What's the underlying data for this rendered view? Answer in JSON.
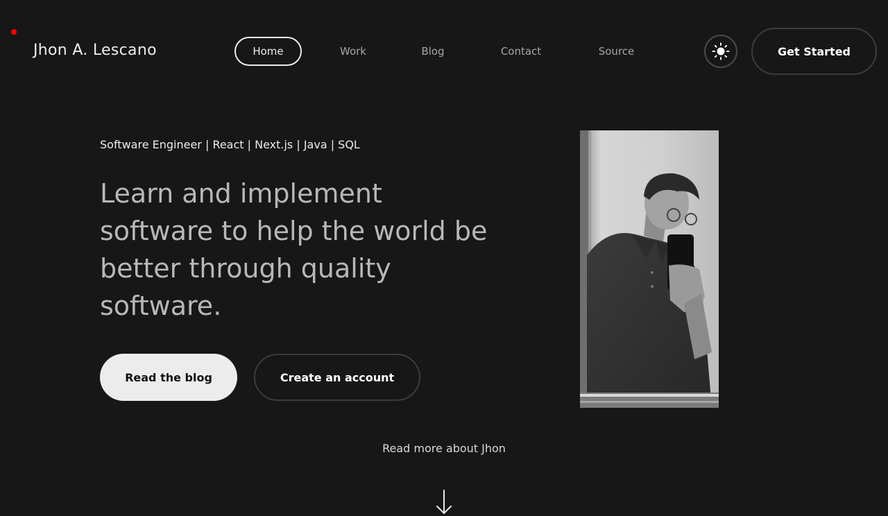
{
  "brand": {
    "name": "Jhon A. Lescano",
    "accent_dot_color": "#ff0000"
  },
  "nav": {
    "items": [
      {
        "label": "Home",
        "active": true
      },
      {
        "label": "Work",
        "active": false
      },
      {
        "label": "Blog",
        "active": false
      },
      {
        "label": "Contact",
        "active": false
      },
      {
        "label": "Source",
        "active": false
      }
    ]
  },
  "header": {
    "theme_toggle_icon": "sun-icon",
    "cta_label": "Get Started"
  },
  "hero": {
    "subtitle": "Software Engineer | React | Next.js | Java | SQL",
    "headline": "Learn and implement software to help the world be better through quality software.",
    "primary_button": "Read the blog",
    "secondary_button": "Create an account",
    "portrait_image": "portrait-photo"
  },
  "footer": {
    "read_more": "Read more about Jhon",
    "scroll_icon": "arrow-down-icon"
  },
  "colors": {
    "background": "#171717",
    "text": "#ececec",
    "muted_text": "#a6a6a6",
    "headline_text": "#b8b8b8",
    "primary_button_bg": "#ececec"
  }
}
